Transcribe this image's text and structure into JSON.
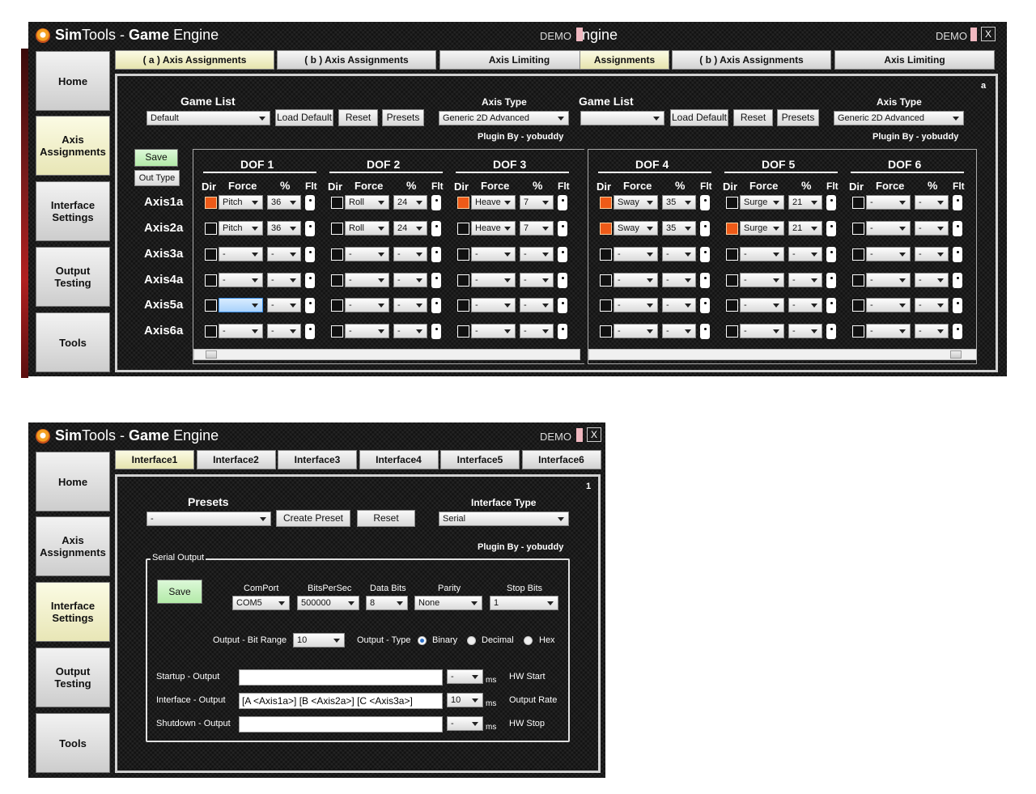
{
  "app": {
    "title_sim": "Sim",
    "title_tools": "Tools",
    "title_dash": " - ",
    "title_game": "Game",
    "title_engine": " Engine",
    "title_engine_clipped": "ngine",
    "demo": "DEMO",
    "close": "X"
  },
  "sidebar": [
    "Home",
    "Axis Assignments",
    "Interface Settings",
    "Output Testing",
    "Tools"
  ],
  "axis_window": {
    "tabs_left": [
      "( a ) Axis Assignments",
      "( b ) Axis Assignments",
      "Axis Limiting"
    ],
    "tabs_right": [
      "Assignments",
      "( b ) Axis Assignments",
      "Axis Limiting"
    ],
    "corner_label": "a",
    "game_list_label": "Game List",
    "game_list_label_clipped": "Game List",
    "game_list_value": "Default",
    "load_default": "Load Default",
    "reset": "Reset",
    "presets": "Presets",
    "axis_type_label": "Axis Type",
    "axis_type_value": "Generic 2D Advanced",
    "plugin_by": "Plugin By - yobuddy",
    "save": "Save",
    "out_type": "Out Type",
    "col_dir": "Dir",
    "col_force": "Force",
    "col_pct": "%",
    "col_flt": "Flt",
    "dof_left": [
      "DOF 1",
      "DOF 2",
      "DOF 3"
    ],
    "dof_right": [
      "DOF 4",
      "DOF 5",
      "DOF 6"
    ],
    "axes": [
      "Axis1a",
      "Axis2a",
      "Axis3a",
      "Axis4a",
      "Axis5a",
      "Axis6a"
    ],
    "grid_left": [
      [
        {
          "on": true,
          "f": "Pitch",
          "p": "36"
        },
        {
          "on": false,
          "f": "Roll",
          "p": "24"
        },
        {
          "on": true,
          "f": "Heave",
          "p": "7"
        }
      ],
      [
        {
          "on": false,
          "f": "Pitch",
          "p": "36"
        },
        {
          "on": false,
          "f": "Roll",
          "p": "24"
        },
        {
          "on": false,
          "f": "Heave",
          "p": "7"
        }
      ],
      [
        {
          "on": false,
          "f": "-",
          "p": "-"
        },
        {
          "on": false,
          "f": "-",
          "p": "-"
        },
        {
          "on": false,
          "f": "-",
          "p": "-"
        }
      ],
      [
        {
          "on": false,
          "f": "-",
          "p": "-"
        },
        {
          "on": false,
          "f": "-",
          "p": "-"
        },
        {
          "on": false,
          "f": "-",
          "p": "-"
        }
      ],
      [
        {
          "on": false,
          "f": "",
          "p": "-",
          "hl": true
        },
        {
          "on": false,
          "f": "-",
          "p": "-"
        },
        {
          "on": false,
          "f": "-",
          "p": "-"
        }
      ],
      [
        {
          "on": false,
          "f": "-",
          "p": "-"
        },
        {
          "on": false,
          "f": "-",
          "p": "-"
        },
        {
          "on": false,
          "f": "-",
          "p": "-"
        }
      ]
    ],
    "grid_right": [
      [
        {
          "on": true,
          "f": "Sway",
          "p": "35"
        },
        {
          "on": false,
          "f": "Surge",
          "p": "21"
        },
        {
          "on": false,
          "f": "-",
          "p": "-"
        }
      ],
      [
        {
          "on": true,
          "f": "Sway",
          "p": "35"
        },
        {
          "on": true,
          "f": "Surge",
          "p": "21"
        },
        {
          "on": false,
          "f": "-",
          "p": "-"
        }
      ],
      [
        {
          "on": false,
          "f": "-",
          "p": "-"
        },
        {
          "on": false,
          "f": "-",
          "p": "-"
        },
        {
          "on": false,
          "f": "-",
          "p": "-"
        }
      ],
      [
        {
          "on": false,
          "f": "-",
          "p": "-"
        },
        {
          "on": false,
          "f": "-",
          "p": "-"
        },
        {
          "on": false,
          "f": "-",
          "p": "-"
        }
      ],
      [
        {
          "on": false,
          "f": "-",
          "p": "-"
        },
        {
          "on": false,
          "f": "-",
          "p": "-"
        },
        {
          "on": false,
          "f": "-",
          "p": "-"
        }
      ],
      [
        {
          "on": false,
          "f": "-",
          "p": "-"
        },
        {
          "on": false,
          "f": "-",
          "p": "-"
        },
        {
          "on": false,
          "f": "-",
          "p": "-"
        }
      ]
    ]
  },
  "interface_window": {
    "tabs": [
      "Interface1",
      "Interface2",
      "Interface3",
      "Interface4",
      "Interface5",
      "Interface6"
    ],
    "corner_label": "1",
    "presets_label": "Presets",
    "presets_value": "-",
    "create_preset": "Create Preset",
    "reset": "Reset",
    "interface_type_label": "Interface Type",
    "interface_type_value": "Serial",
    "plugin_by": "Plugin By - yobuddy",
    "serial_output": "Serial Output",
    "save": "Save",
    "comport_label": "ComPort",
    "comport_value": "COM5",
    "bps_label": "BitsPerSec",
    "bps_value": "500000",
    "databits_label": "Data Bits",
    "databits_value": "8",
    "parity_label": "Parity",
    "parity_value": "None",
    "stopbits_label": "Stop Bits",
    "stopbits_value": "1",
    "bitrange_label": "Output - Bit Range",
    "bitrange_value": "10",
    "outtype_label": "Output - Type",
    "radio_binary": "Binary",
    "radio_decimal": "Decimal",
    "radio_hex": "Hex",
    "startup_label": "Startup - Output",
    "startup_value": "",
    "startup_ms": "-",
    "interface_label": "Interface - Output",
    "interface_value": "[A <Axis1a>] [B <Axis2a>] [C <Axis3a>]",
    "interface_ms": "10",
    "shutdown_label": "Shutdown - Output",
    "shutdown_value": "",
    "shutdown_ms": "-",
    "ms": "ms",
    "hw_start": "HW Start",
    "output_rate": "Output Rate",
    "hw_stop": "HW Stop"
  }
}
